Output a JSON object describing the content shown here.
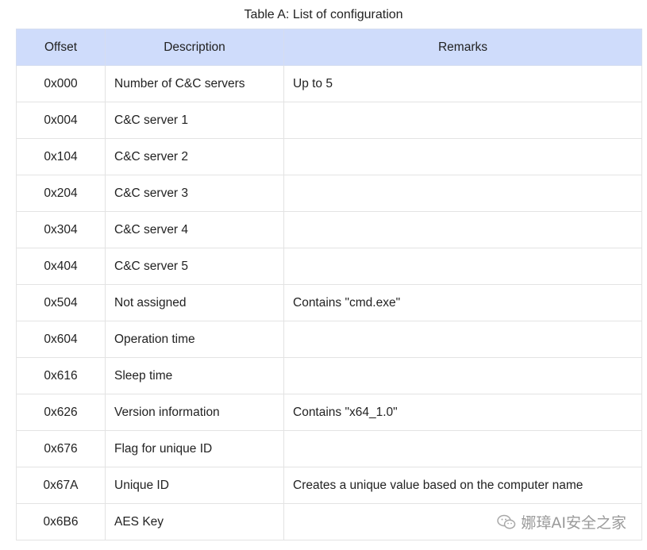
{
  "caption": "Table A: List of configuration",
  "table": {
    "headers": [
      "Offset",
      "Description",
      "Remarks"
    ],
    "rows": [
      [
        "0x000",
        "Number of C&C servers",
        "Up to 5"
      ],
      [
        "0x004",
        "C&C server 1",
        ""
      ],
      [
        "0x104",
        "C&C server 2",
        ""
      ],
      [
        "0x204",
        "C&C server 3",
        ""
      ],
      [
        "0x304",
        "C&C server 4",
        ""
      ],
      [
        "0x404",
        "C&C server 5",
        ""
      ],
      [
        "0x504",
        "Not assigned",
        "Contains \"cmd.exe\""
      ],
      [
        "0x604",
        "Operation time",
        ""
      ],
      [
        "0x616",
        "Sleep time",
        ""
      ],
      [
        "0x626",
        "Version information",
        "Contains \"x64_1.0\""
      ],
      [
        "0x676",
        "Flag for unique ID",
        ""
      ],
      [
        "0x67A",
        "Unique ID",
        "Creates a unique value based on the computer name"
      ],
      [
        "0x6B6",
        "AES Key",
        ""
      ]
    ]
  },
  "watermark": {
    "text": "娜璋AI安全之家",
    "icon": "wechat-icon"
  }
}
